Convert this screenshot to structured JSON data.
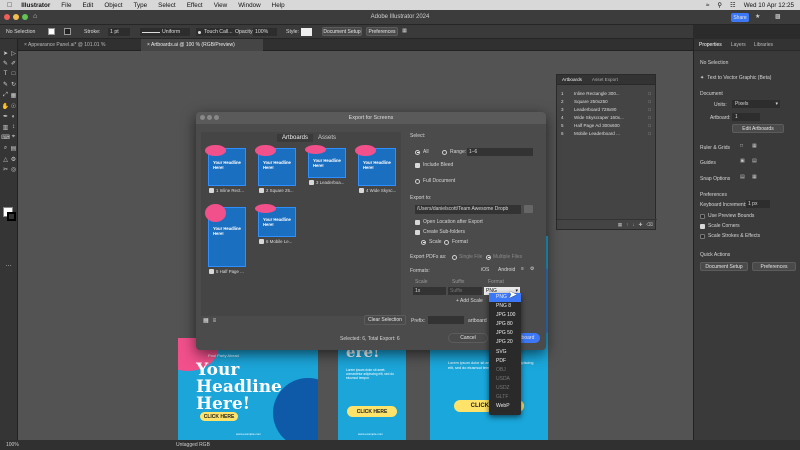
{
  "menubar": {
    "items": [
      "Illustrator",
      "File",
      "Edit",
      "Object",
      "Type",
      "Select",
      "Effect",
      "View",
      "Window",
      "Help"
    ],
    "clock": "Wed 10 Apr  12:25"
  },
  "titlebar": {
    "title": "Adobe Illustrator 2024",
    "share": "Share"
  },
  "control": {
    "selection": "No Selection",
    "stroke_label": "Stroke:",
    "stroke_value": "1 pt",
    "uniform": "Uniform",
    "brush": "Touch Call...",
    "opacity_label": "Opacity:",
    "opacity_value": "100%",
    "style_label": "Style:",
    "document_setup": "Document Setup",
    "preferences": "Preferences"
  },
  "tabs": [
    {
      "label": "Appearance Panel.ai* @ 101.01 % (RGB/Preview)"
    },
    {
      "label": "Artboards.ai @ 100 % (RGB/Preview)"
    }
  ],
  "right_panel": {
    "tabs": [
      "Properties",
      "Layers",
      "Libraries"
    ],
    "no_selection": "No Selection",
    "text_to_vector": "Text to Vector Graphic (Beta)",
    "document": "Document",
    "units_label": "Units:",
    "units_value": "Pixels",
    "artboard_label": "Artboard:",
    "artboard_value": "1",
    "edit_artboards": "Edit Artboards",
    "ruler_grids": "Ruler & Grids",
    "guides": "Guides",
    "snap_options": "Snap Options",
    "preferences_title": "Preferences",
    "keyboard_increment": "Keyboard Increment:",
    "keyboard_value": "1 px",
    "use_preview_bounds": "Use Preview Bounds",
    "scale_corners": "Scale Corners",
    "scale_strokes": "Scale Strokes & Effects",
    "quick_actions": "Quick Actions",
    "document_setup": "Document Setup",
    "preferences_btn": "Preferences"
  },
  "artboards_panel": {
    "tabs": [
      "Artboards",
      "Asset Export"
    ],
    "items": [
      {
        "num": "1",
        "name": "Inline Rectangle 300..."
      },
      {
        "num": "2",
        "name": "Square 250x250"
      },
      {
        "num": "3",
        "name": "Leaderboard 728x90"
      },
      {
        "num": "4",
        "name": "Wide Skyscraper 160x..."
      },
      {
        "num": "5",
        "name": "Half Page Ad 300x600"
      },
      {
        "num": "6",
        "name": "Mobile Leaderboard ..."
      }
    ]
  },
  "dialog": {
    "title": "Export for Screens",
    "tab_artboards": "Artboards",
    "tab_assets": "Assets",
    "thumbs": [
      {
        "num": "1",
        "name": "Inline Rect..."
      },
      {
        "num": "2",
        "name": "Square 25..."
      },
      {
        "num": "3",
        "name": "Leaderboa..."
      },
      {
        "num": "4",
        "name": "Wide Skysc..."
      },
      {
        "num": "5",
        "name": "Half Page ..."
      },
      {
        "num": "6",
        "name": "Mobile Le..."
      }
    ],
    "thumb_headline": "Your Headline Here!",
    "select_label": "Select:",
    "all": "All",
    "range": "Range:",
    "range_value": "1–6",
    "include_bleed": "Include Bleed",
    "full_document": "Full Document",
    "export_to": "Export to:",
    "path": "/Users/danielscott/Team Awesome Dropb",
    "open_location": "Open Location after Export",
    "create_subfolders": "Create Sub-folders",
    "scale": "Scale",
    "format_radio": "Format",
    "export_pdfs": "Export PDFs as:",
    "single_file": "Single File",
    "multiple_files": "Multiple Files",
    "formats": "Formats:",
    "ios": "iOS",
    "android": "Android",
    "col_scale": "Scale",
    "col_suffix": "Suffix",
    "col_format": "Format",
    "scale_value": "1x",
    "suffix_placeholder": "Suffix",
    "format_value": "PNG",
    "add_scale": "+ Add Scale",
    "clear_selection": "Clear Selection",
    "prefix_label": "Prefix:",
    "artboards_word": "artboard",
    "selected_total": "Selected: 6, Total Export: 6",
    "cancel": "Cancel",
    "export_artboard": "Export Artboard"
  },
  "format_menu": [
    "PNG",
    "PNG 8",
    "JPG 100",
    "JPG 80",
    "JPG 50",
    "JPG 20",
    "SVG",
    "PDF",
    "OBJ",
    "USDA",
    "USDZ",
    "GLTF",
    "WebP"
  ],
  "canvas": {
    "headline": "Your Headline Here!",
    "subhead": "Lorem ipsum dolor sit amet, consectetur adipiscing elit, sed do eiusmod tempor.",
    "click_here": "CLICK HERE",
    "website": "www.example.com",
    "day_label": "Pool Party Ahead",
    "here_fragment": "ere!"
  },
  "status": {
    "zoom": "100%",
    "mode": "Untagged RGB"
  }
}
